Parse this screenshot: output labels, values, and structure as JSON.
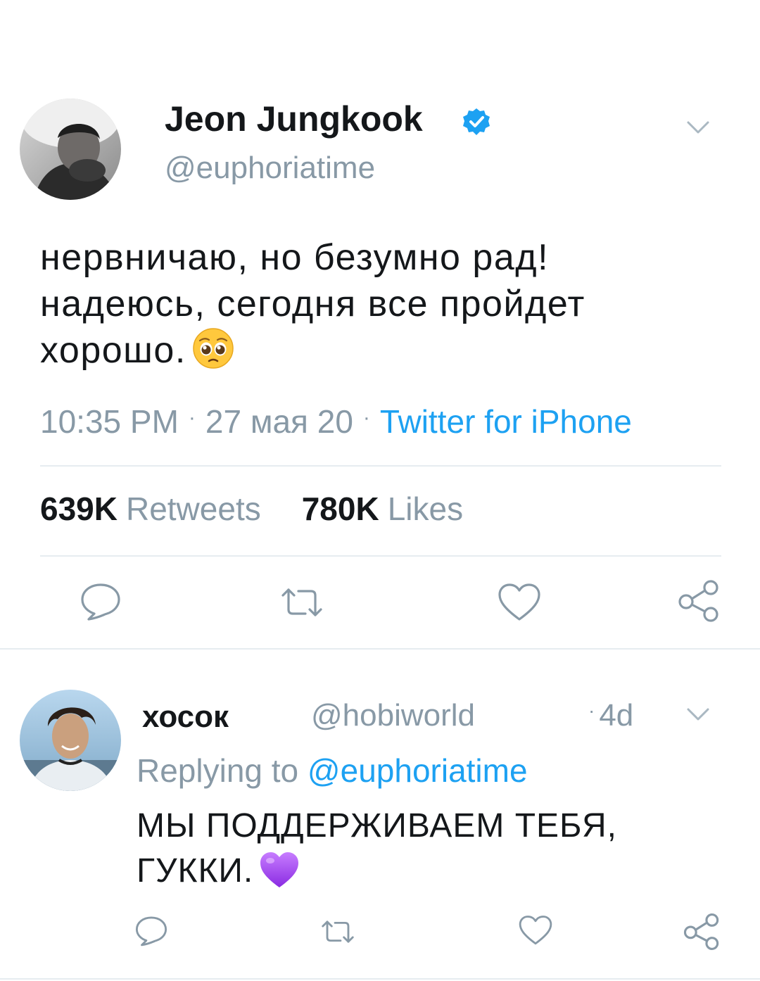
{
  "tweet": {
    "author_name": "Jeon Jungkook",
    "verified_icon": "verified-badge-icon",
    "handle": "@euphoriatime",
    "text_lines": [
      "нервничаю, но безумно рад!",
      "надеюсь, сегодня все пройдет",
      "хорошо."
    ],
    "emoji": "pleading-face-emoji",
    "time": "10:35 PM",
    "date": "27 мая 20",
    "source": "Twitter for iPhone",
    "retweets_count": "639K",
    "retweets_label": "Retweets",
    "likes_count": "780K",
    "likes_label": "Likes"
  },
  "reply": {
    "author_name": "хосок",
    "handle": "@hobiworld",
    "time": "4d",
    "replying_prefix": "Replying to",
    "replying_mention": "@euphoriatime",
    "text_lines": [
      "МЫ ПОДДЕРЖИВАЕМ ТЕБЯ,",
      "ГУККИ."
    ],
    "emoji": "purple-heart-emoji"
  },
  "icons": [
    "reply-icon",
    "retweet-icon",
    "like-icon",
    "share-icon",
    "chevron-down-icon"
  ],
  "colors": {
    "link": "#1da1f2",
    "secondary": "#8899a6",
    "text": "#14171a",
    "divider": "#e6ecf0"
  }
}
